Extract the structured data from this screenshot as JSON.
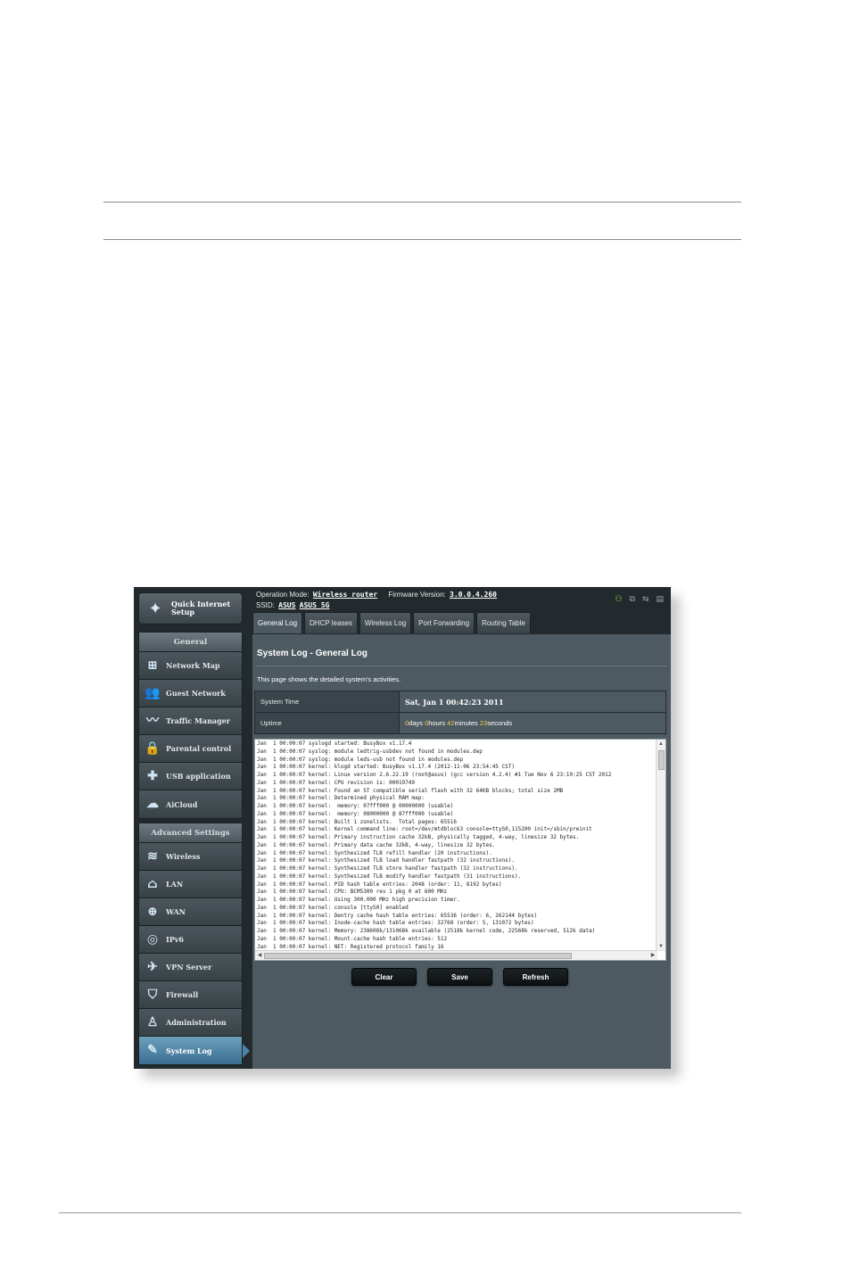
{
  "header": {
    "operation_mode_label": "Operation Mode:",
    "operation_mode_value": "Wireless router",
    "firmware_label": "Firmware Version:",
    "firmware_value": "3.0.0.4.260",
    "ssid_label": "SSID:",
    "ssid_1": "ASUS",
    "ssid_2": "ASUS_5G",
    "status_icons": [
      "user-icon",
      "network-status-icon",
      "usb-icon",
      "printer-icon"
    ]
  },
  "sidebar": {
    "quick_setup": "Quick Internet Setup",
    "general_title": "General",
    "general_items": [
      {
        "label": "Network Map",
        "icon": "network-map-icon"
      },
      {
        "label": "Guest Network",
        "icon": "guest-network-icon"
      },
      {
        "label": "Traffic Manager",
        "icon": "traffic-manager-icon"
      },
      {
        "label": "Parental control",
        "icon": "lock-icon"
      },
      {
        "label": "USB application",
        "icon": "puzzle-icon"
      },
      {
        "label": "AiCloud",
        "icon": "cloud-icon"
      }
    ],
    "advanced_title": "Advanced Settings",
    "advanced_items": [
      {
        "label": "Wireless",
        "icon": "wifi-icon"
      },
      {
        "label": "LAN",
        "icon": "home-icon"
      },
      {
        "label": "WAN",
        "icon": "globe-icon"
      },
      {
        "label": "IPv6",
        "icon": "ipv6-icon"
      },
      {
        "label": "VPN Server",
        "icon": "vpn-icon"
      },
      {
        "label": "Firewall",
        "icon": "shield-icon"
      },
      {
        "label": "Administration",
        "icon": "admin-icon"
      },
      {
        "label": "System Log",
        "icon": "edit-icon"
      }
    ]
  },
  "tabs": [
    "General Log",
    "DHCP leases",
    "Wireless Log",
    "Port Forwarding",
    "Routing Table"
  ],
  "panel": {
    "title": "System Log - General Log",
    "description": "This page shows the detailed system's activities.",
    "system_time_label": "System Time",
    "system_time_value": "Sat, Jan 1  00:42:23  2011",
    "uptime_label": "Uptime",
    "uptime": {
      "days": "0",
      "hours": "0",
      "minutes": "42",
      "seconds": "23",
      "days_unit": "days",
      "hours_unit": "hours",
      "minutes_unit": "minutes",
      "seconds_unit": "seconds"
    },
    "log": "Jan  1 00:00:07 syslogd started: BusyBox v1.17.4\nJan  1 00:00:07 syslog: module ledtrig-usbdev not found in modules.dep\nJan  1 00:00:07 syslog: module leds-usb not found in modules.dep\nJan  1 00:00:07 kernel: klogd started: BusyBox v1.17.4 (2012-11-06 23:54:45 CST)\nJan  1 00:00:07 kernel: Linux version 2.6.22.19 (root@asus) (gcc version 4.2.4) #1 Tue Nov 6 23:19:25 CST 2012\nJan  1 00:00:07 kernel: CPU revision is: 00019749\nJan  1 00:00:07 kernel: Found an ST compatible serial flash with 32 64KB blocks; total size 2MB\nJan  1 00:00:07 kernel: Determined physical RAM map:\nJan  1 00:00:07 kernel:  memory: 07fff000 @ 00000000 (usable)\nJan  1 00:00:07 kernel:  memory: 08000000 @ 87fff000 (usable)\nJan  1 00:00:07 kernel: Built 1 zonelists.  Total pages: 65516\nJan  1 00:00:07 kernel: Kernel command line: root=/dev/mtdblock3 console=ttyS0,115200 init=/sbin/preinit\nJan  1 00:00:07 kernel: Primary instruction cache 32kB, physically tagged, 4-way, linesize 32 bytes.\nJan  1 00:00:07 kernel: Primary data cache 32kB, 4-way, linesize 32 bytes.\nJan  1 00:00:07 kernel: Synthesized TLB refill handler (20 instructions).\nJan  1 00:00:07 kernel: Synthesized TLB load handler fastpath (32 instructions).\nJan  1 00:00:07 kernel: Synthesized TLB store handler fastpath (32 instructions).\nJan  1 00:00:07 kernel: Synthesized TLB modify handler fastpath (31 instructions).\nJan  1 00:00:07 kernel: PID hash table entries: 2048 (order: 11, 8192 bytes)\nJan  1 00:00:07 kernel: CPU: BCM5300 rev 1 pkg 0 at 600 MHz\nJan  1 00:00:07 kernel: Using 300.000 MHz high precision timer.\nJan  1 00:00:07 kernel: console [ttyS0] enabled\nJan  1 00:00:07 kernel: Dentry cache hash table entries: 65536 (order: 6, 262144 bytes)\nJan  1 00:00:07 kernel: Inode-cache hash table entries: 32768 (order: 5, 131072 bytes)\nJan  1 00:00:07 kernel: Memory: 238608k/131068k available (2518k kernel code, 22568k reserved, 512k data)\nJan  1 00:00:07 kernel: Mount-cache hash table entries: 512\nJan  1 00:00:07 kernel: NET: Registered protocol family 16",
    "buttons": {
      "clear": "Clear",
      "save": "Save",
      "refresh": "Refresh"
    }
  }
}
